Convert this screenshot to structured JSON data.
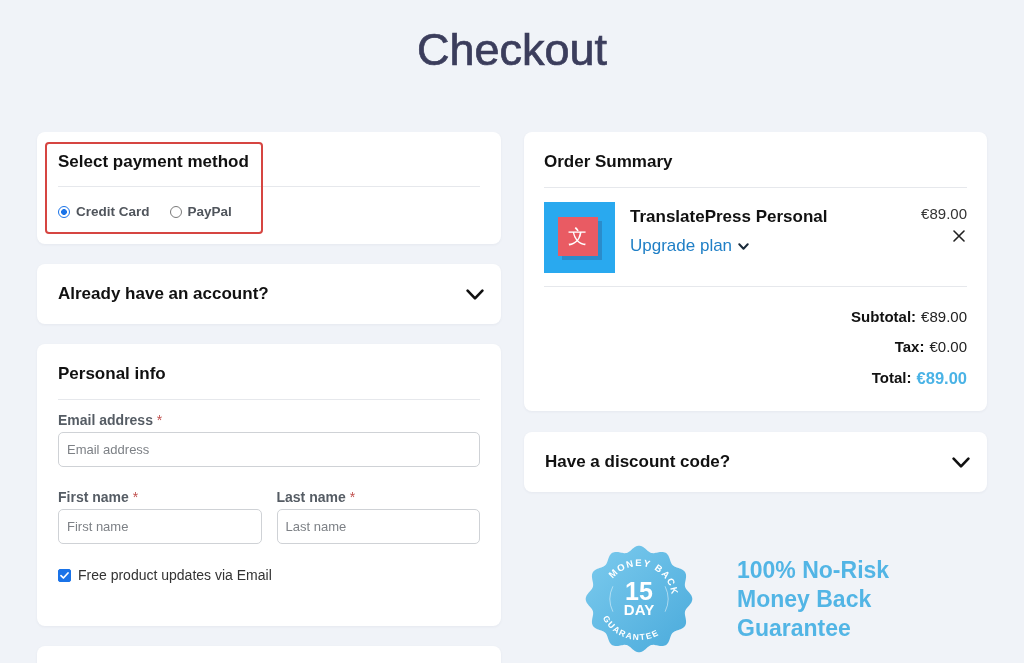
{
  "page": {
    "title": "Checkout"
  },
  "payment": {
    "heading": "Select payment method",
    "highlighted": true,
    "options": [
      {
        "label": "Credit Card",
        "selected": true
      },
      {
        "label": "PayPal",
        "selected": false
      }
    ]
  },
  "account": {
    "heading": "Already have an account?",
    "expanded": false
  },
  "personal_info": {
    "heading": "Personal info",
    "field_rows": [
      [
        {
          "label": "Email address",
          "required_mark": "*",
          "placeholder": "Email address"
        }
      ],
      [
        {
          "label": "First name",
          "required_mark": "*",
          "placeholder": "First name"
        },
        {
          "label": "Last name",
          "required_mark": "*",
          "placeholder": "Last name"
        }
      ]
    ],
    "updates_opt_in": {
      "label": "Free product updates via Email",
      "checked": true
    }
  },
  "order_summary": {
    "heading": "Order Summary",
    "items": [
      {
        "logo_glyph": "文",
        "name": "TranslatePress Personal",
        "upgrade_link": "Upgrade plan",
        "price": "€89.00"
      }
    ],
    "totals": [
      {
        "kind": "subtotal",
        "label": "Subtotal:",
        "value": "€89.00"
      },
      {
        "kind": "tax",
        "label": "Tax:",
        "value": "€0.00"
      },
      {
        "kind": "total",
        "label": "Total:",
        "value": "€89.00"
      }
    ]
  },
  "discount": {
    "heading": "Have a discount code?",
    "expanded": false
  },
  "guarantee": {
    "badge": {
      "top_text": "MONEY BACK",
      "number": "15",
      "unit": "DAY",
      "bottom_text": "GUARANTEE"
    },
    "headline": "100% No-Risk Money Back Guarantee"
  }
}
